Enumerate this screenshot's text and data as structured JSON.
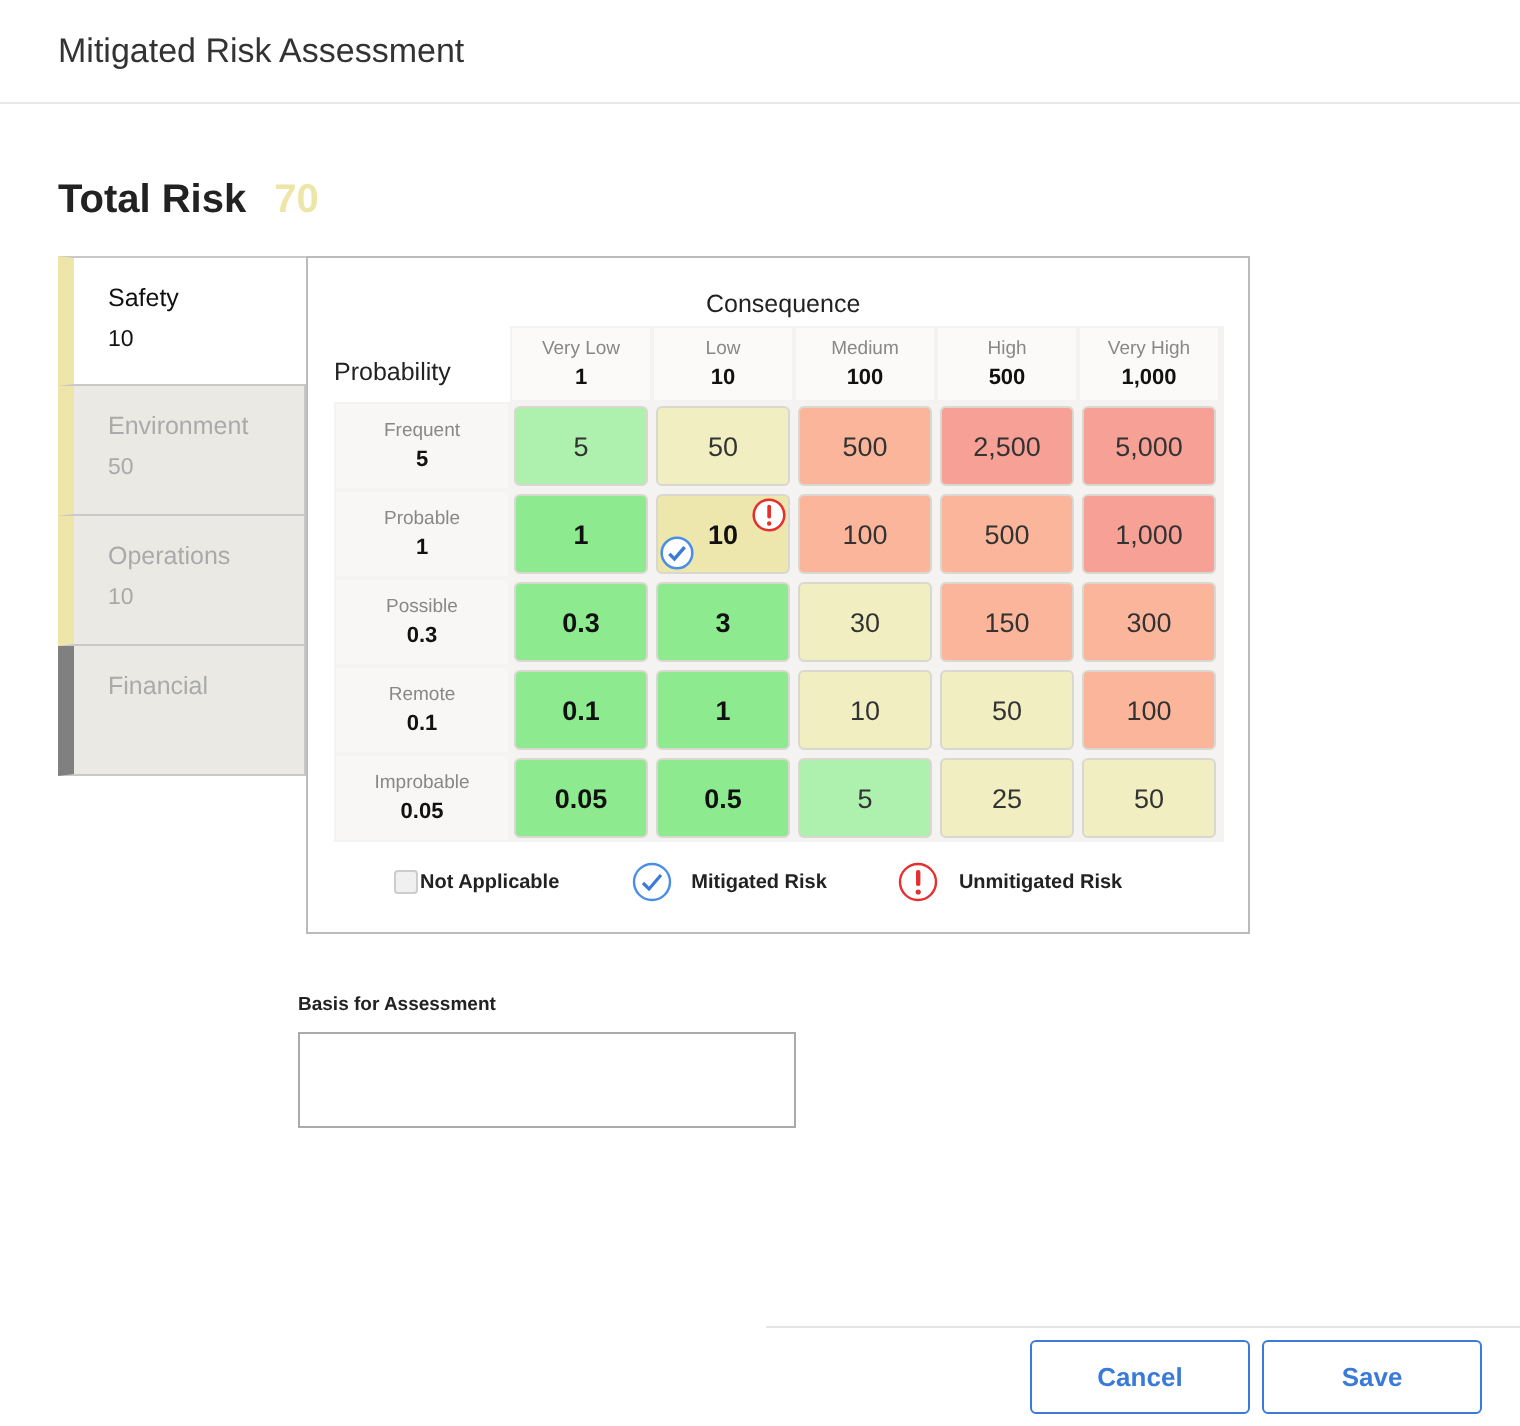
{
  "header": {
    "title": "Mitigated Risk Assessment"
  },
  "total_risk": {
    "label": "Total Risk",
    "value": "70"
  },
  "tabs": [
    {
      "label": "Safety",
      "value": "10",
      "selected": true,
      "color": "#eee6a8"
    },
    {
      "label": "Environment",
      "value": "50",
      "selected": false,
      "color": "#eee6a8"
    },
    {
      "label": "Operations",
      "value": "10",
      "selected": false,
      "color": "#eee6a8"
    },
    {
      "label": "Financial",
      "selected": false,
      "color": "#808080"
    }
  ],
  "matrix": {
    "consequence_label": "Consequence",
    "probability_label": "Probability",
    "columns": [
      {
        "label": "Very Low",
        "value": "1"
      },
      {
        "label": "Low",
        "value": "10"
      },
      {
        "label": "Medium",
        "value": "100"
      },
      {
        "label": "High",
        "value": "500"
      },
      {
        "label": "Very High",
        "value": "1,000"
      }
    ],
    "rows": [
      {
        "label": "Frequent",
        "value": "5",
        "cells": [
          {
            "value": "5",
            "color": "#aef0ae",
            "bold": false,
            "mitigated": false,
            "unmitigated": false
          },
          {
            "value": "50",
            "color": "#f1eec2",
            "bold": false,
            "mitigated": false,
            "unmitigated": false
          },
          {
            "value": "500",
            "color": "#fbb59a",
            "bold": false,
            "mitigated": false,
            "unmitigated": false
          },
          {
            "value": "2,500",
            "color": "#f7a096",
            "bold": false,
            "mitigated": false,
            "unmitigated": false
          },
          {
            "value": "5,000",
            "color": "#f7a096",
            "bold": false,
            "mitigated": false,
            "unmitigated": false
          }
        ]
      },
      {
        "label": "Probable",
        "value": "1",
        "cells": [
          {
            "value": "1",
            "color": "#8eea8e",
            "bold": true,
            "mitigated": false,
            "unmitigated": false
          },
          {
            "value": "10",
            "color": "#ede6ad",
            "bold": true,
            "mitigated": true,
            "unmitigated": true
          },
          {
            "value": "100",
            "color": "#fbb59a",
            "bold": false,
            "mitigated": false,
            "unmitigated": false
          },
          {
            "value": "500",
            "color": "#fbb59a",
            "bold": false,
            "mitigated": false,
            "unmitigated": false
          },
          {
            "value": "1,000",
            "color": "#f7a096",
            "bold": false,
            "mitigated": false,
            "unmitigated": false
          }
        ]
      },
      {
        "label": "Possible",
        "value": "0.3",
        "cells": [
          {
            "value": "0.3",
            "color": "#8eea8e",
            "bold": true,
            "mitigated": false,
            "unmitigated": false
          },
          {
            "value": "3",
            "color": "#8eea8e",
            "bold": true,
            "mitigated": false,
            "unmitigated": false
          },
          {
            "value": "30",
            "color": "#f1eec2",
            "bold": false,
            "mitigated": false,
            "unmitigated": false
          },
          {
            "value": "150",
            "color": "#fbb59a",
            "bold": false,
            "mitigated": false,
            "unmitigated": false
          },
          {
            "value": "300",
            "color": "#fbb59a",
            "bold": false,
            "mitigated": false,
            "unmitigated": false
          }
        ]
      },
      {
        "label": "Remote",
        "value": "0.1",
        "cells": [
          {
            "value": "0.1",
            "color": "#8eea8e",
            "bold": true,
            "mitigated": false,
            "unmitigated": false
          },
          {
            "value": "1",
            "color": "#8eea8e",
            "bold": true,
            "mitigated": false,
            "unmitigated": false
          },
          {
            "value": "10",
            "color": "#f1eec2",
            "bold": false,
            "mitigated": false,
            "unmitigated": false
          },
          {
            "value": "50",
            "color": "#f1eec2",
            "bold": false,
            "mitigated": false,
            "unmitigated": false
          },
          {
            "value": "100",
            "color": "#fbb59a",
            "bold": false,
            "mitigated": false,
            "unmitigated": false
          }
        ]
      },
      {
        "label": "Improbable",
        "value": "0.05",
        "cells": [
          {
            "value": "0.05",
            "color": "#8eea8e",
            "bold": true,
            "mitigated": false,
            "unmitigated": false
          },
          {
            "value": "0.5",
            "color": "#8eea8e",
            "bold": true,
            "mitigated": false,
            "unmitigated": false
          },
          {
            "value": "5",
            "color": "#aef0ae",
            "bold": false,
            "mitigated": false,
            "unmitigated": false
          },
          {
            "value": "25",
            "color": "#f1eec2",
            "bold": false,
            "mitigated": false,
            "unmitigated": false
          },
          {
            "value": "50",
            "color": "#f1eec2",
            "bold": false,
            "mitigated": false,
            "unmitigated": false
          }
        ]
      }
    ]
  },
  "legend": {
    "not_applicable": {
      "label": "Not Applicable",
      "checked": false
    },
    "mitigated": "Mitigated Risk",
    "unmitigated": "Unmitigated Risk"
  },
  "basis": {
    "label": "Basis for Assessment"
  },
  "buttons": [
    "Cancel",
    "Save"
  ]
}
